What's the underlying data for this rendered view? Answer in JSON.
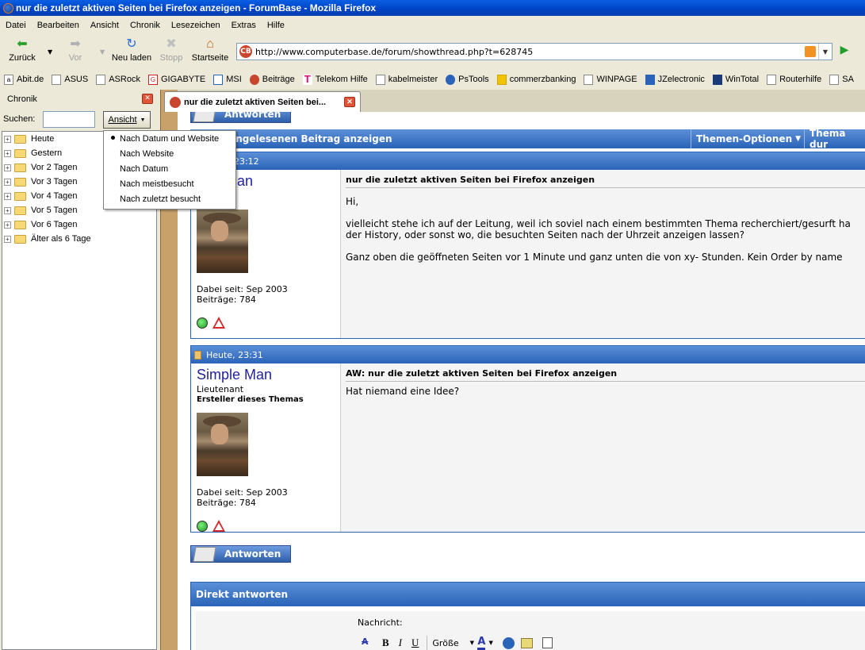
{
  "window": {
    "title": "nur die zuletzt aktiven Seiten bei Firefox anzeigen - ForumBase - Mozilla Firefox"
  },
  "menu": [
    "Datei",
    "Bearbeiten",
    "Ansicht",
    "Chronik",
    "Lesezeichen",
    "Extras",
    "Hilfe"
  ],
  "nav": {
    "back": "Zurück",
    "forward": "Vor",
    "reload": "Neu laden",
    "stop": "Stopp",
    "home": "Startseite",
    "url": "http://www.computerbase.de/forum/showthread.php?t=628745"
  },
  "bookmarks": [
    "Abit.de",
    "ASUS",
    "ASRock",
    "GIGABYTE",
    "MSI",
    "Beiträge",
    "Telekom Hilfe",
    "kabelmeister",
    "PsTools",
    "commerzbanking",
    "WINPAGE",
    "JZelectronic",
    "WinTotal",
    "Routerhilfe",
    "SA"
  ],
  "sidebar": {
    "title": "Chronik",
    "search_label": "Suchen:",
    "search_value": "",
    "view_button": "Ansicht",
    "items": [
      "Heute",
      "Gestern",
      "Vor 2 Tagen",
      "Vor 3 Tagen",
      "Vor 4 Tagen",
      "Vor 5 Tagen",
      "Vor 6 Tagen",
      "Älter als 6 Tage"
    ]
  },
  "view_menu": {
    "items": [
      "Nach Datum und Website",
      "Nach Website",
      "Nach Datum",
      "Nach meistbesucht",
      "Nach zuletzt besucht"
    ],
    "selected_index": 0
  },
  "tab": {
    "label": "nur die zuletzt aktiven Seiten bei..."
  },
  "page": {
    "reply_button": "Antworten",
    "nav_bar": {
      "first_unread": "n ungelesenen Beitrag anzeigen",
      "thread_options": "Themen-Optionen",
      "thread_search": "Thema dur"
    },
    "posts": [
      {
        "date": "n, 23:12",
        "username": "e Man",
        "rank": "nt",
        "starter": "",
        "joined": "Dabei seit: Sep 2003",
        "count": "Beiträge: 784",
        "title": "nur die zuletzt aktiven Seiten bei Firefox anzeigen",
        "lines": [
          "Hi,",
          "",
          "vielleicht stehe ich auf der Leitung, weil ich soviel nach einem bestimmten Thema recherchiert/gesurft ha",
          "der History, oder sonst wo, die besuchten Seiten nach der Uhrzeit anzeigen lassen?",
          "",
          "Ganz oben die geöffneten Seiten vor 1 Minute und ganz unten die von xy- Stunden. Kein Order by name"
        ]
      },
      {
        "date": "Heute, 23:31",
        "username": "Simple Man",
        "rank": "Lieutenant",
        "starter": "Ersteller dieses Themas",
        "joined": "Dabei seit: Sep 2003",
        "count": "Beiträge: 784",
        "title": "AW: nur die zuletzt aktiven Seiten bei Firefox anzeigen",
        "lines": [
          "Hat niemand eine Idee?"
        ]
      }
    ],
    "quick_reply": {
      "title": "Direkt antworten",
      "message_label": "Nachricht:",
      "size_select": "Größe"
    }
  },
  "colors": {
    "forum_blue": "#2a64b8",
    "title_blue": "#0043c4",
    "username": "#22229a"
  }
}
